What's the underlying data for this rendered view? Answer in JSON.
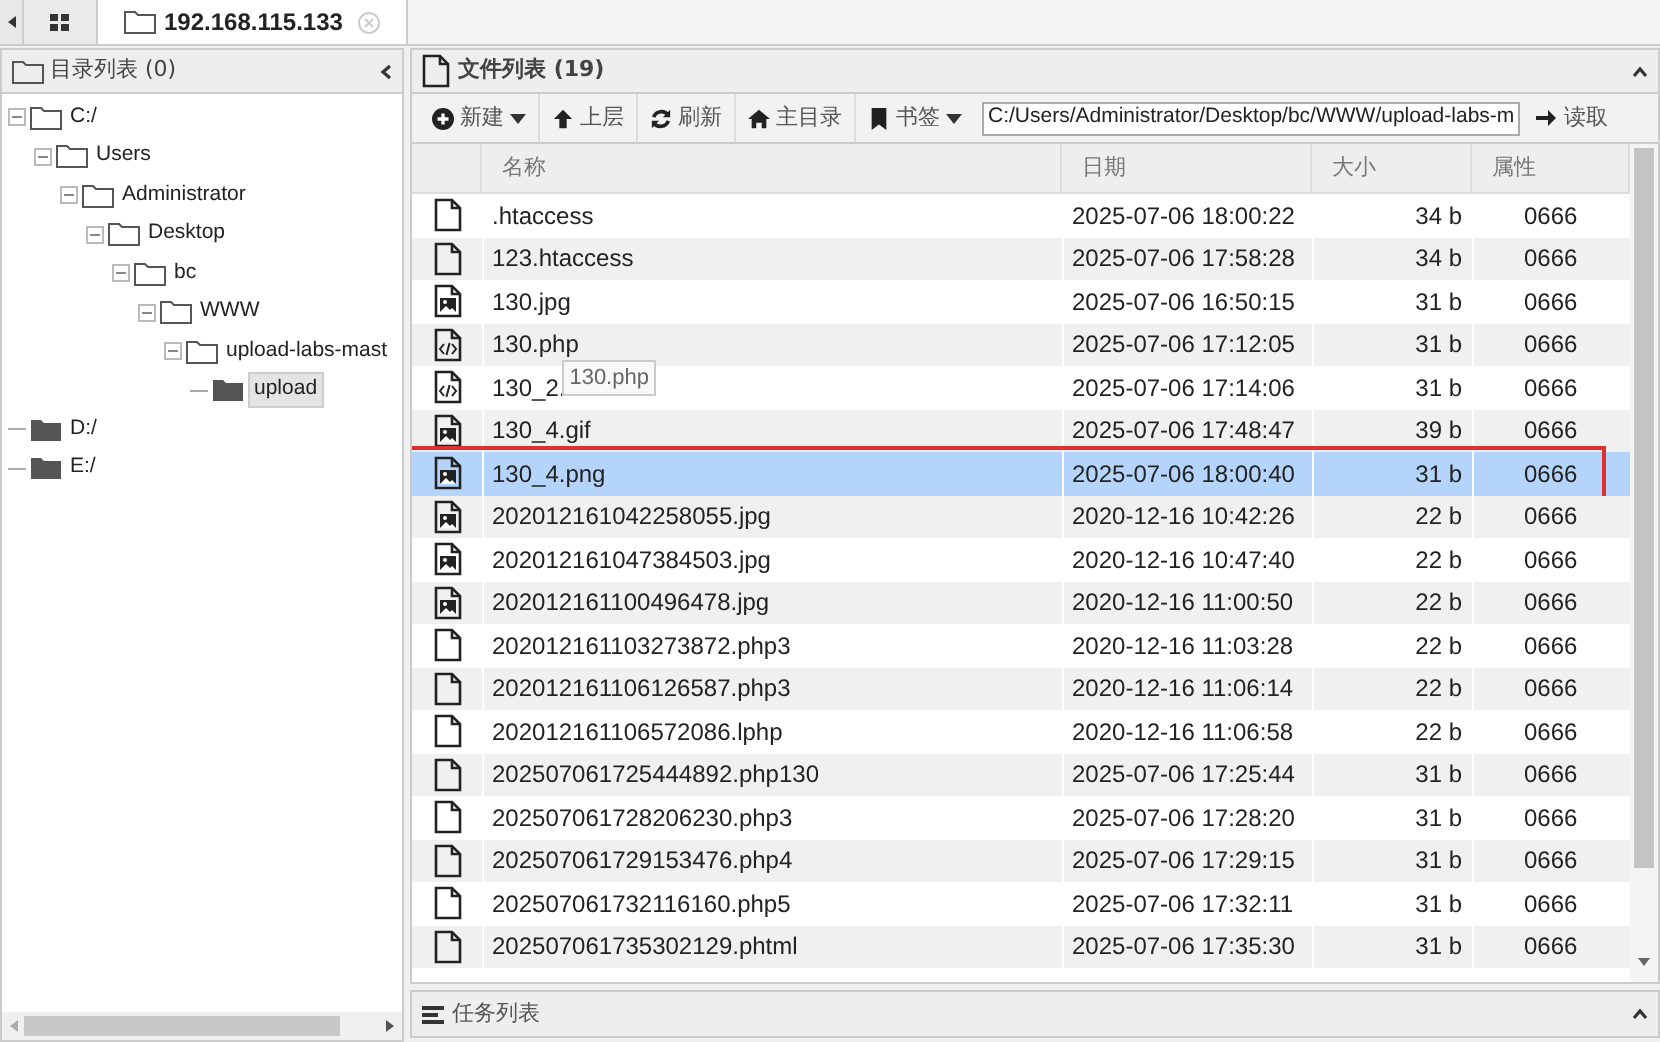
{
  "tabs": [
    {
      "kind": "grid",
      "selected": false
    },
    {
      "kind": "site",
      "label": "192.168.115.133",
      "selected": true
    }
  ],
  "tree_panel": {
    "title": "目录列表 (0)",
    "items": [
      {
        "label": "C:/",
        "expanded": true,
        "selected": false,
        "children": [
          {
            "label": "Users",
            "expanded": true,
            "selected": false,
            "children": [
              {
                "label": "Administrator",
                "expanded": true,
                "selected": false,
                "children": [
                  {
                    "label": "Desktop",
                    "expanded": true,
                    "selected": false,
                    "children": [
                      {
                        "label": "bc",
                        "expanded": true,
                        "selected": false,
                        "children": [
                          {
                            "label": "WWW",
                            "expanded": true,
                            "selected": false,
                            "children": [
                              {
                                "label": "upload-labs-mast",
                                "expanded": true,
                                "selected": false,
                                "children": [
                                  {
                                    "label": "upload",
                                    "expanded": false,
                                    "selected": true
                                  }
                                ]
                              }
                            ]
                          }
                        ]
                      }
                    ]
                  }
                ]
              }
            ]
          }
        ]
      },
      {
        "label": "D:/",
        "expanded": false,
        "selected": false
      },
      {
        "label": "E:/",
        "expanded": false,
        "selected": false
      }
    ]
  },
  "file_panel": {
    "title": "文件列表 (19)",
    "toolbar": [
      {
        "kind": "new",
        "label": "新建",
        "dropdown": true
      },
      {
        "kind": "up",
        "label": "上层",
        "dropdown": false
      },
      {
        "kind": "refresh",
        "label": "刷新",
        "dropdown": false
      },
      {
        "kind": "home",
        "label": "主目录",
        "dropdown": false
      },
      {
        "kind": "bookmark",
        "label": "书签",
        "dropdown": true
      }
    ],
    "path": "C:/Users/Administrator/Desktop/bc/WWW/upload-labs-m",
    "read_button": "读取",
    "columns": [
      "名称",
      "日期",
      "大小",
      "属性"
    ],
    "rows": [
      {
        "kind": "file",
        "name": ".htaccess",
        "date": "2025-07-06 18:00:22",
        "size": "34 b",
        "attr": "0666",
        "selected": false
      },
      {
        "kind": "file",
        "name": "123.htaccess",
        "date": "2025-07-06 17:58:28",
        "size": "34 b",
        "attr": "0666",
        "selected": false
      },
      {
        "kind": "image",
        "name": "130.jpg",
        "date": "2025-07-06 16:50:15",
        "size": "31 b",
        "attr": "0666",
        "selected": false
      },
      {
        "kind": "code",
        "name": "130.php",
        "date": "2025-07-06 17:12:05",
        "size": "31 b",
        "attr": "0666",
        "selected": false
      },
      {
        "kind": "code",
        "name": "130_2.",
        "date": "2025-07-06 17:14:06",
        "size": "31 b",
        "attr": "0666",
        "selected": false,
        "tooltip": "130.php"
      },
      {
        "kind": "image",
        "name": "130_4.gif",
        "date": "2025-07-06 17:48:47",
        "size": "39 b",
        "attr": "0666",
        "selected": false
      },
      {
        "kind": "image",
        "name": "130_4.png",
        "date": "2025-07-06 18:00:40",
        "size": "31 b",
        "attr": "0666",
        "selected": true,
        "annotated": true
      },
      {
        "kind": "image",
        "name": "202012161042258055.jpg",
        "date": "2020-12-16 10:42:26",
        "size": "22 b",
        "attr": "0666",
        "selected": false
      },
      {
        "kind": "image",
        "name": "202012161047384503.jpg",
        "date": "2020-12-16 10:47:40",
        "size": "22 b",
        "attr": "0666",
        "selected": false
      },
      {
        "kind": "image",
        "name": "202012161100496478.jpg",
        "date": "2020-12-16 11:00:50",
        "size": "22 b",
        "attr": "0666",
        "selected": false
      },
      {
        "kind": "file",
        "name": "202012161103273872.php3",
        "date": "2020-12-16 11:03:28",
        "size": "22 b",
        "attr": "0666",
        "selected": false
      },
      {
        "kind": "file",
        "name": "202012161106126587.php3",
        "date": "2020-12-16 11:06:14",
        "size": "22 b",
        "attr": "0666",
        "selected": false
      },
      {
        "kind": "file",
        "name": "202012161106572086.lphp",
        "date": "2020-12-16 11:06:58",
        "size": "22 b",
        "attr": "0666",
        "selected": false
      },
      {
        "kind": "file",
        "name": "202507061725444892.php130",
        "date": "2025-07-06 17:25:44",
        "size": "31 b",
        "attr": "0666",
        "selected": false
      },
      {
        "kind": "file",
        "name": "202507061728206230.php3",
        "date": "2025-07-06 17:28:20",
        "size": "31 b",
        "attr": "0666",
        "selected": false
      },
      {
        "kind": "file",
        "name": "202507061729153476.php4",
        "date": "2025-07-06 17:29:15",
        "size": "31 b",
        "attr": "0666",
        "selected": false
      },
      {
        "kind": "file",
        "name": "202507061732116160.php5",
        "date": "2025-07-06 17:32:11",
        "size": "31 b",
        "attr": "0666",
        "selected": false
      },
      {
        "kind": "file",
        "name": "202507061735302129.phtml",
        "date": "2025-07-06 17:35:30",
        "size": "31 b",
        "attr": "0666",
        "selected": false
      }
    ]
  },
  "task_panel": {
    "title": "任务列表"
  }
}
